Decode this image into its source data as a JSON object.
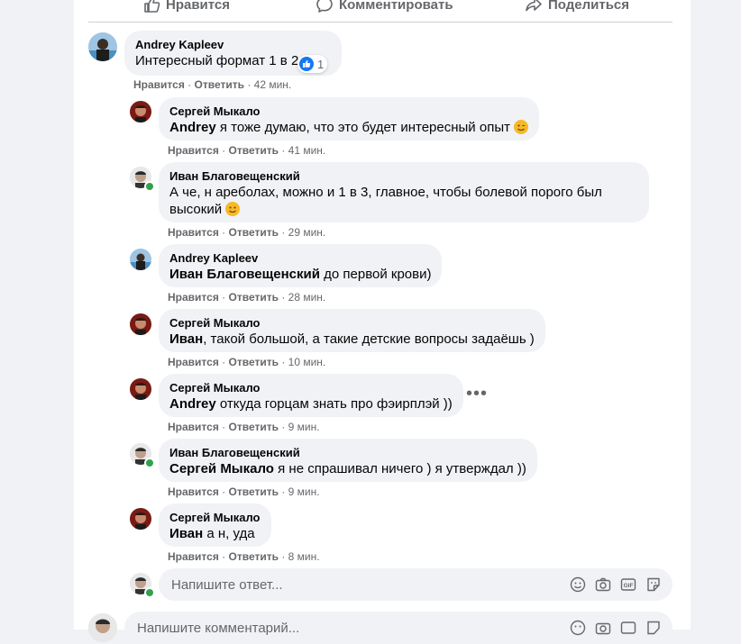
{
  "actions": {
    "like": "Нравится",
    "comment": "Комментировать",
    "share": "Поделиться"
  },
  "main_comment": {
    "author": "Andrey Kapleev",
    "text": "Интересный формат 1 в 2",
    "reaction_count": "1",
    "like": "Нравится",
    "reply": "Ответить",
    "time": "42 мин."
  },
  "replies": [
    {
      "author": "Сергей Мыкало",
      "mention": "Andrey",
      "text": " я тоже думаю, что это будет интересный опыт ",
      "like": "Нравится",
      "reply": "Ответить",
      "time": "41 мин."
    },
    {
      "author": "Иван Благовещенский",
      "mention": "",
      "text": "А че, н ареболах, можно и 1 в 3, главное, чтобы болевой порого был",
      "text2": "высокий ",
      "like": "Нравится",
      "reply": "Ответить",
      "time": "29 мин."
    },
    {
      "author": "Andrey Kapleev",
      "mention": "Иван Благовещенский",
      "text": " до первой крови)",
      "like": "Нравится",
      "reply": "Ответить",
      "time": "28 мин."
    },
    {
      "author": "Сергей Мыкало",
      "mention": "Иван",
      "text": ", такой большой, а такие детские вопросы задаёшь )",
      "like": "Нравится",
      "reply": "Ответить",
      "time": "10 мин."
    },
    {
      "author": "Сергей Мыкало",
      "mention": "Andrey",
      "text": " откуда горцам знать про фэирплэй ))",
      "like": "Нравится",
      "reply": "Ответить",
      "time": "9 мин."
    },
    {
      "author": "Иван Благовещенский",
      "mention": "Сергей Мыкало",
      "text": " я не спрашивал ничего ) я утверждал ))",
      "like": "Нравится",
      "reply": "Ответить",
      "time": "9 мин."
    },
    {
      "author": "Сергей Мыкало",
      "mention": "Иван",
      "text": " а н, уда",
      "like": "Нравится",
      "reply": "Ответить",
      "time": "8 мин."
    }
  ],
  "separator": "·",
  "reply_input": {
    "placeholder": "Напишите ответ..."
  },
  "comment_input": {
    "placeholder": "Напишите комментарий..."
  },
  "colors": {
    "accent": "#1877f2",
    "bubble": "#f0f2f5",
    "online": "#31a24c"
  }
}
